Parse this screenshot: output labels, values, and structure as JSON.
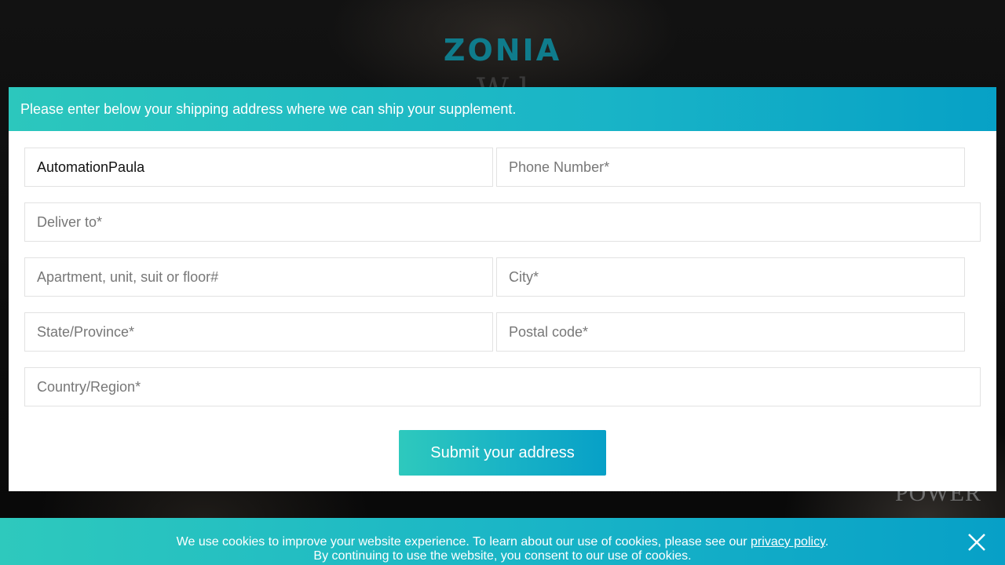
{
  "background": {
    "logo": "ZONIA",
    "heading_partial": "W  l",
    "deco_text": "POWER"
  },
  "modal": {
    "header_text": "Please enter below your shipping address where we can ship your supplement.",
    "fields": {
      "name": {
        "value": "AutomationPaula",
        "placeholder": ""
      },
      "phone": {
        "value": "",
        "placeholder": "Phone Number*"
      },
      "deliver_to": {
        "value": "",
        "placeholder": "Deliver to*"
      },
      "apartment": {
        "value": "",
        "placeholder": "Apartment, unit, suit or floor#"
      },
      "city": {
        "value": "",
        "placeholder": "City*"
      },
      "state": {
        "value": "",
        "placeholder": "State/Province*"
      },
      "postal": {
        "value": "",
        "placeholder": "Postal code*"
      },
      "country": {
        "value": "",
        "placeholder": "Country/Region*"
      }
    },
    "submit_label": "Submit your address"
  },
  "cookie_bar": {
    "text_before": "We use cookies to improve your website experience. To learn about our use of cookies, please see our ",
    "link_text": "privacy policy",
    "text_after": ". By continuing to use the website, you consent to our use of cookies.",
    "close_icon": "close-icon"
  },
  "colors": {
    "accent_start": "#2ec9bd",
    "accent_end": "#07a0c7",
    "logo": "#0f7c8c"
  }
}
